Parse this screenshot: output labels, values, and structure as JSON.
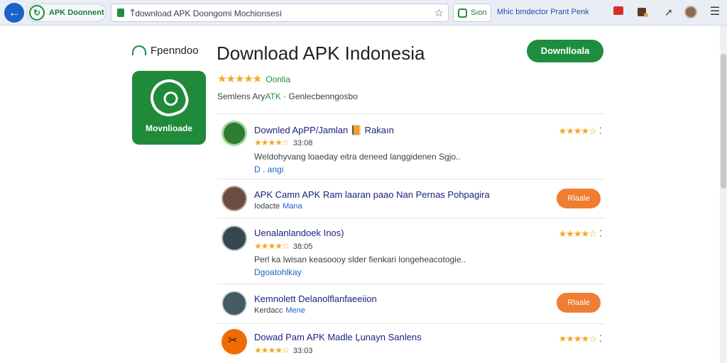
{
  "browser": {
    "tab_label": "APK Doonnent",
    "url": "Ťdownload APK Doongomi Mochionsesí",
    "sign_label": "Sıon",
    "extension_text": "Mhic bmdector Prant Penk"
  },
  "header": {
    "brand_text": "Fpenndoo",
    "app_icon_label": "Movnlioade",
    "title": "Download APK Indonesia",
    "download_label": "Downlloala",
    "stars": "★★★★★",
    "rating_label": "Oonlia",
    "meta_prefix": "Semlens Ary",
    "meta_highlight": "ATK",
    "meta_suffix": "Genlecbenngosbo"
  },
  "items": [
    {
      "title": "Downled ApPP/Jamlan 📙 Rakaın",
      "stars": "★★★★☆",
      "num": "33:08",
      "desc": "Weldohyvang loaeday eitra deneed langgidenen Sgjo..",
      "link": "D . angi",
      "side_stars": "★★★★☆",
      "more": "⁚"
    },
    {
      "title": "APK Camn APK Ram laaran paao Nan Pernas Pohpagira",
      "meta_prefix": "Iodacte",
      "meta_link": "Mana",
      "pill": "Rlaale"
    },
    {
      "title": "Uenalanlandoek Inos)",
      "stars": "★★★★☆",
      "num": "38:05",
      "desc": "Perl ka lwisan keasoooy slder fienkari longeheacotogie..",
      "link": "Dgoatohlkay",
      "side_stars": "★★★★☆",
      "more": "⁚"
    },
    {
      "title": "Kemnolett Delanolflanfaeeiion",
      "meta_prefix": "Kerdacc",
      "meta_link": "Mene",
      "pill": "Rlaale"
    },
    {
      "title": "Dowad Pam APK Madle Ļunayn Sanlens",
      "stars": "★★★★☆",
      "num": "33:03",
      "side_stars": "★★★★☆",
      "more": "⁚"
    }
  ],
  "colors": {
    "brand_green": "#1e8e3e",
    "pill_orange": "#ef7d32",
    "star": "#f5a623",
    "title_blue": "#1a237e"
  }
}
